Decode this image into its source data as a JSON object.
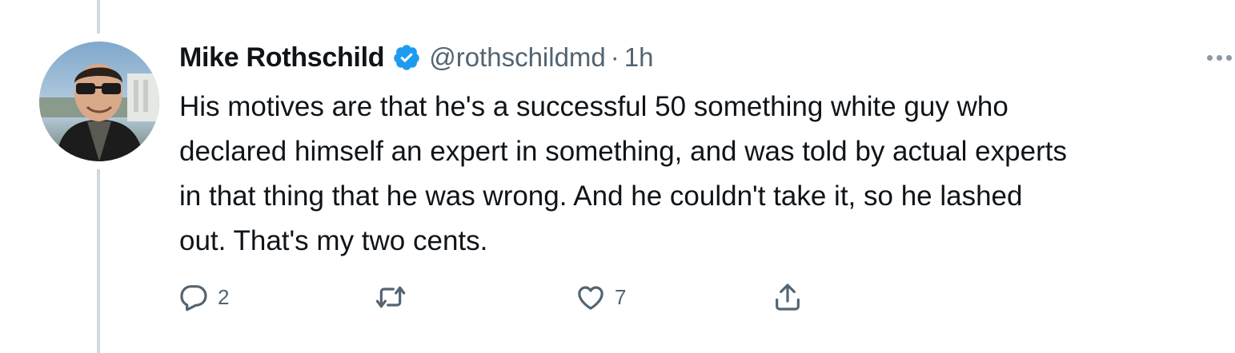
{
  "tweet": {
    "author_name": "Mike Rothschild",
    "handle": "@rothschildmd",
    "separator": "·",
    "time": "1h",
    "verified": true,
    "text": "His motives are that he's a successful 50 something white guy who\ndeclared himself an expert in something, and was told by actual experts\nin that thing that he was wrong. And he couldn't take it, so he lashed\nout. That's my two cents."
  },
  "actions": {
    "reply_count": "2",
    "like_count": "7",
    "icons": [
      "reply-icon",
      "retweet-icon",
      "like-icon",
      "share-icon"
    ]
  },
  "colors": {
    "verified": "#1d9bf0",
    "muted_text": "#536471",
    "thread_line": "#cfd9de",
    "text": "#0f1419"
  }
}
